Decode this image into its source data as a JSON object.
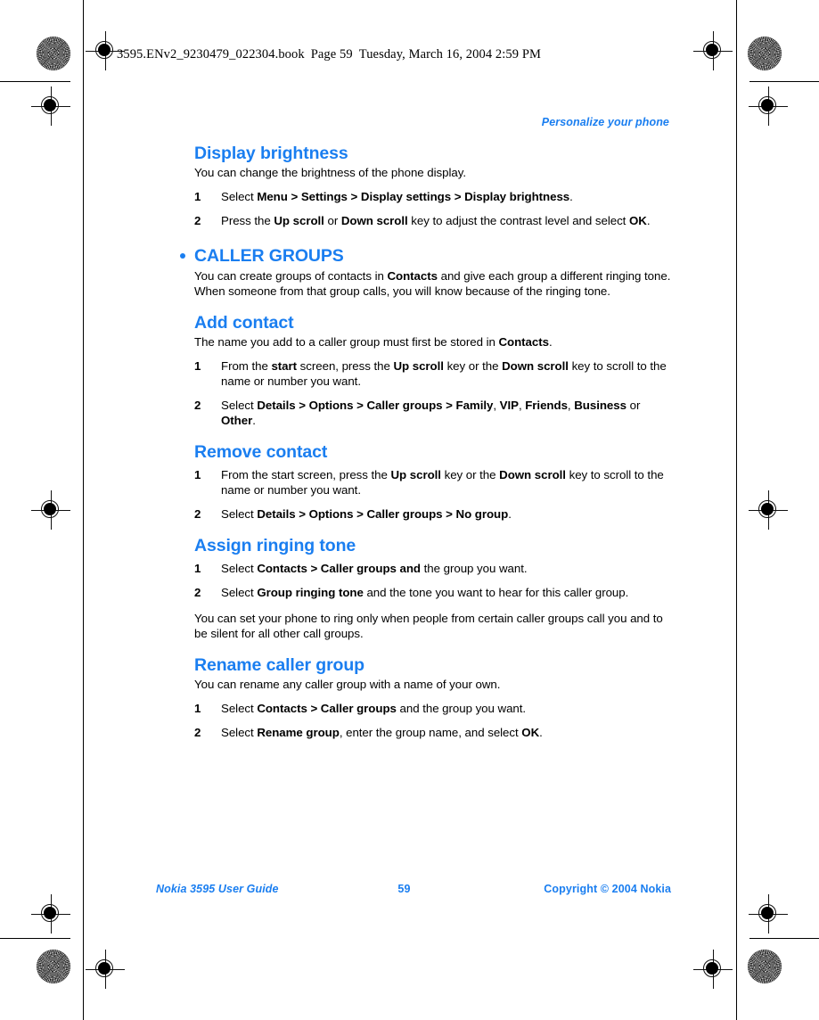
{
  "slug": {
    "filename": "3595.ENv2_9230479_022304.book",
    "page_label": "Page 59",
    "timestamp": "Tuesday, March 16, 2004  2:59 PM"
  },
  "running_head": "Personalize your phone",
  "colors": {
    "heading_blue": "#1a7ef0",
    "body_black": "#000000",
    "page_background": "#ffffff"
  },
  "sections": [
    {
      "id": "display-brightness",
      "level": "h2",
      "title": "Display brightness",
      "intro": "You can change the brightness of the phone display.",
      "steps": [
        {
          "num": "1",
          "parts": [
            {
              "t": "Select ",
              "b": false
            },
            {
              "t": "Menu > Settings > Display settings > Display brightness",
              "b": true
            },
            {
              "t": ".",
              "b": false
            }
          ]
        },
        {
          "num": "2",
          "parts": [
            {
              "t": "Press the ",
              "b": false
            },
            {
              "t": "Up scroll",
              "b": true
            },
            {
              "t": " or ",
              "b": false
            },
            {
              "t": "Down scroll",
              "b": true
            },
            {
              "t": " key to adjust the contrast level and select ",
              "b": false
            },
            {
              "t": "OK",
              "b": true
            },
            {
              "t": ".",
              "b": false
            }
          ]
        }
      ]
    },
    {
      "id": "caller-groups",
      "level": "h1",
      "title": "CALLER GROUPS",
      "bullet": true,
      "intro_parts": [
        {
          "t": "You can create groups of contacts in ",
          "b": false
        },
        {
          "t": "Contacts",
          "b": true
        },
        {
          "t": " and give each group a different ringing tone. When someone from that group calls, you will know because of the ringing tone.",
          "b": false
        }
      ]
    },
    {
      "id": "add-contact",
      "level": "h2",
      "title": "Add contact",
      "intro_parts": [
        {
          "t": "The name you add to a caller group must first be stored in ",
          "b": false
        },
        {
          "t": "Contacts",
          "b": true
        },
        {
          "t": ".",
          "b": false
        }
      ],
      "steps": [
        {
          "num": "1",
          "parts": [
            {
              "t": "From the ",
              "b": false
            },
            {
              "t": "start",
              "b": true
            },
            {
              "t": " screen, press the ",
              "b": false
            },
            {
              "t": "Up scroll",
              "b": true
            },
            {
              "t": " key or the ",
              "b": false
            },
            {
              "t": "Down scroll",
              "b": true
            },
            {
              "t": " key to scroll to the name or number you want.",
              "b": false
            }
          ]
        },
        {
          "num": "2",
          "parts": [
            {
              "t": "Select ",
              "b": false
            },
            {
              "t": "Details > Options > Caller groups > Family",
              "b": true
            },
            {
              "t": ", ",
              "b": false
            },
            {
              "t": "VIP",
              "b": true
            },
            {
              "t": ", ",
              "b": false
            },
            {
              "t": "Friends",
              "b": true
            },
            {
              "t": ", ",
              "b": false
            },
            {
              "t": "Business",
              "b": true
            },
            {
              "t": " or ",
              "b": false
            },
            {
              "t": "Other",
              "b": true
            },
            {
              "t": ".",
              "b": false
            }
          ]
        }
      ]
    },
    {
      "id": "remove-contact",
      "level": "h2",
      "title": "Remove contact",
      "steps": [
        {
          "num": "1",
          "parts": [
            {
              "t": "From the start screen, press the ",
              "b": false
            },
            {
              "t": "Up scroll",
              "b": true
            },
            {
              "t": " key or the ",
              "b": false
            },
            {
              "t": "Down scroll",
              "b": true
            },
            {
              "t": " key to scroll to the name or number you want.",
              "b": false
            }
          ]
        },
        {
          "num": "2",
          "parts": [
            {
              "t": "Select ",
              "b": false
            },
            {
              "t": "Details > Options > Caller groups > No group",
              "b": true
            },
            {
              "t": ".",
              "b": false
            }
          ]
        }
      ]
    },
    {
      "id": "assign-ringing-tone",
      "level": "h2",
      "title": "Assign ringing tone",
      "steps": [
        {
          "num": "1",
          "parts": [
            {
              "t": "Select ",
              "b": false
            },
            {
              "t": "Contacts > Caller groups and",
              "b": true
            },
            {
              "t": " the group you want.",
              "b": false
            }
          ]
        },
        {
          "num": "2",
          "parts": [
            {
              "t": "Select ",
              "b": false
            },
            {
              "t": "Group ringing tone",
              "b": true
            },
            {
              "t": " and the tone you want to hear for this caller group.",
              "b": false
            }
          ]
        }
      ],
      "outro": "You can set your phone to ring only when people from certain caller groups call you and to be silent for all other call groups."
    },
    {
      "id": "rename-caller-group",
      "level": "h2",
      "title": "Rename caller group",
      "intro": "You can rename any caller group with a name of your own.",
      "steps": [
        {
          "num": "1",
          "parts": [
            {
              "t": "Select ",
              "b": false
            },
            {
              "t": "Contacts > Caller groups",
              "b": true
            },
            {
              "t": " and the group you want.",
              "b": false
            }
          ]
        },
        {
          "num": "2",
          "parts": [
            {
              "t": "Select ",
              "b": false
            },
            {
              "t": "Rename group",
              "b": true
            },
            {
              "t": ", enter the group name, and select ",
              "b": false
            },
            {
              "t": "OK",
              "b": true
            },
            {
              "t": ".",
              "b": false
            }
          ]
        }
      ]
    }
  ],
  "footer": {
    "left": "Nokia 3595 User Guide",
    "center": "59",
    "right": "Copyright © 2004 Nokia"
  }
}
